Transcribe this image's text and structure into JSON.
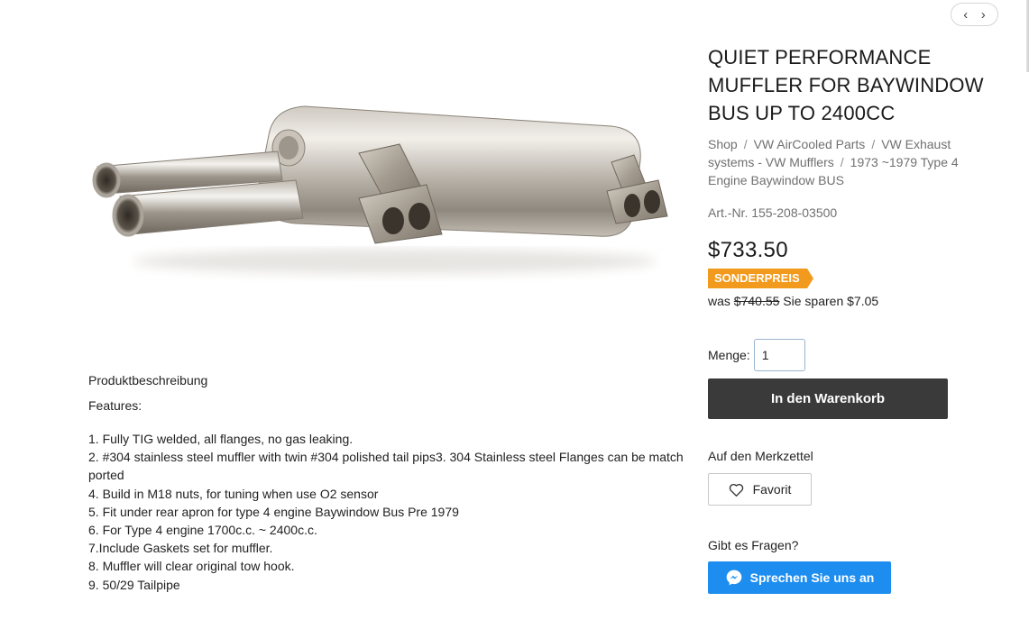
{
  "pager": {
    "prev_icon": "‹",
    "next_icon": "›"
  },
  "product": {
    "title": "QUIET PERFORMANCE MUFFLER FOR BAYWINDOW BUS UP TO 2400CC",
    "breadcrumb": [
      "Shop",
      "VW AirCooled Parts",
      "VW Exhaust systems - VW Mufflers",
      "1973 ~1979 Type 4 Engine Baywindow BUS"
    ],
    "breadcrumb_separator": "/",
    "article_number": "Art.-Nr. 155-208-03500",
    "price": "$733.50",
    "badge": "SONDERPREIS",
    "was_label": "was",
    "old_price": "$740.55",
    "savings_text": "Sie sparen $7.05",
    "quantity_label": "Menge:",
    "quantity_value": "1",
    "add_to_cart_label": "In den Warenkorb",
    "wishlist_label": "Auf den Merkzettel",
    "favorite_label": "Favorit",
    "questions_label": "Gibt es Fragen?",
    "chat_label": "Sprechen Sie uns an"
  },
  "description": {
    "heading": "Produktbeschreibung",
    "features_label": "Features:",
    "items": [
      "1. Fully TIG welded, all flanges, no gas leaking.",
      "2. #304 stainless steel muffler with twin #304 polished tail pips3. 304 Stainless steel Flanges can be match ported",
      "4. Build in M18 nuts, for tuning when use O2 sensor",
      "5. Fit under rear apron for type 4 engine Baywindow Bus Pre 1979",
      "6. For Type 4 engine 1700c.c. ~ 2400c.c.",
      "7.Include Gaskets set for muffler.",
      "8. Muffler will clear original tow hook.",
      "9. 50/29 Tailpipe"
    ]
  },
  "colors": {
    "badge": "#f29a1d",
    "cart_button": "#3a3a3a",
    "chat_button": "#1d8ef0",
    "muted_text": "#707070"
  },
  "icons": {
    "favorite": "heart-icon",
    "chat": "messenger-icon",
    "prev": "chevron-left-icon",
    "next": "chevron-right-icon"
  }
}
